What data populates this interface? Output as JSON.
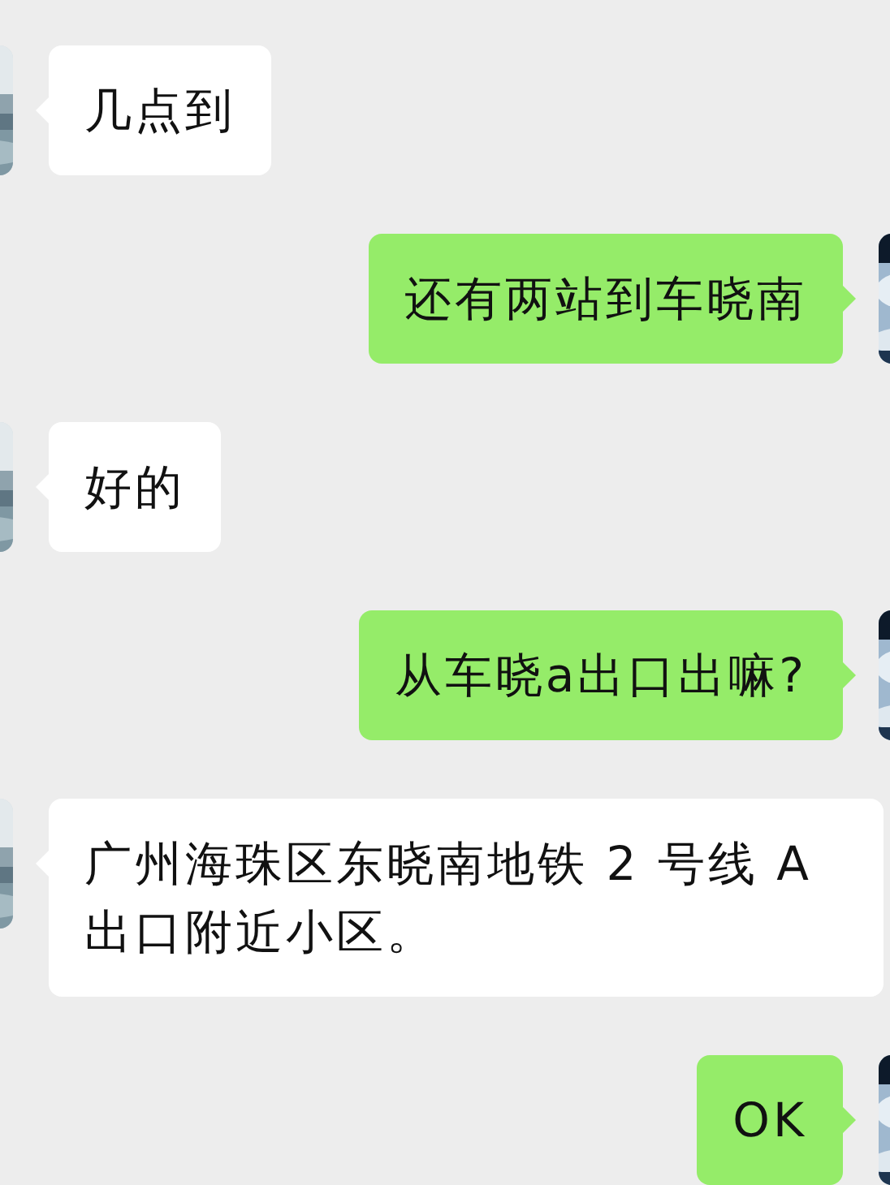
{
  "messages": [
    {
      "kind": "received",
      "text": "几点到"
    },
    {
      "kind": "sent",
      "text": "还有两站到车晓南"
    },
    {
      "kind": "received",
      "text": "好的"
    },
    {
      "kind": "sent",
      "text": "从车晓a出口出嘛?"
    },
    {
      "kind": "received",
      "text": "广州海珠区东晓南地铁 2 号线 A 出口附近小区。"
    },
    {
      "kind": "sent",
      "text": "OK"
    }
  ]
}
